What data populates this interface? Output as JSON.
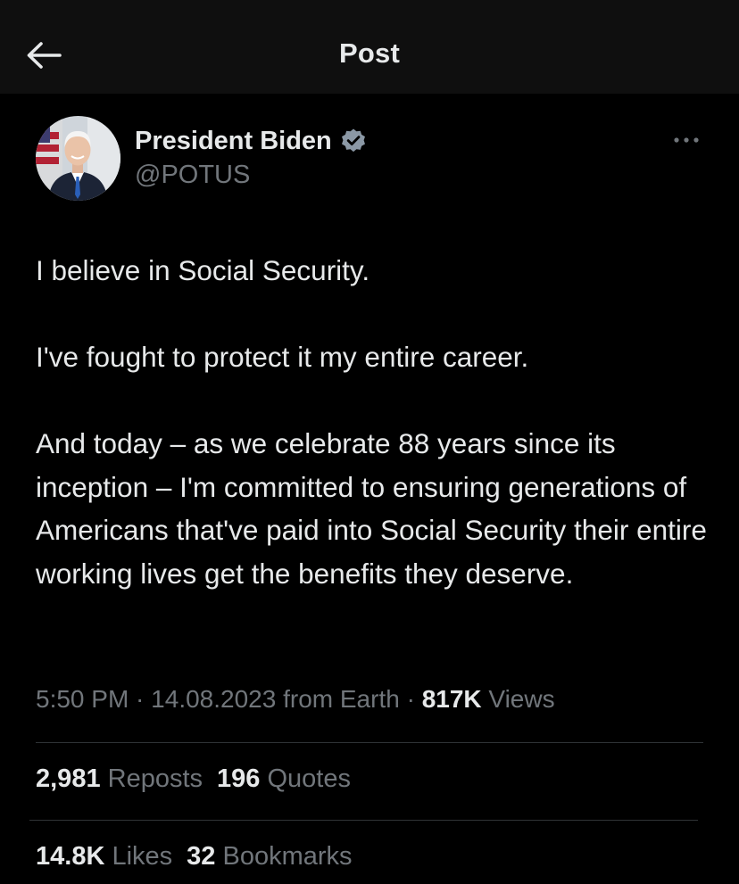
{
  "header": {
    "title": "Post",
    "back_icon": "arrow-left-icon"
  },
  "author": {
    "display_name": "President Biden",
    "handle": "@POTUS",
    "verified": true,
    "badge_color": "#8b98a5",
    "more_icon": "more-horizontal-icon"
  },
  "post": {
    "paragraphs": [
      "I believe in Social Security.",
      "I've fought to protect it my entire career.",
      "And today – as we celebrate 88 years since its inception – I'm committed to ensuring generations of Americans that've paid into Social Security their entire working lives get the benefits they deserve."
    ]
  },
  "meta": {
    "time": "5:50 PM",
    "separator": " · ",
    "date_source": "14.08.2023 from Earth",
    "views_count": "817K",
    "views_label": "Views"
  },
  "engagement": {
    "reposts_count": "2,981",
    "reposts_label": "Reposts",
    "quotes_count": "196",
    "quotes_label": "Quotes",
    "likes_count": "14.8K",
    "likes_label": "Likes",
    "bookmarks_count": "32",
    "bookmarks_label": "Bookmarks"
  },
  "colors": {
    "background": "#000000",
    "header_background": "#0f0f0f",
    "text_primary": "#e7e9ea",
    "text_secondary": "#71767b",
    "divider": "#2f3336"
  }
}
